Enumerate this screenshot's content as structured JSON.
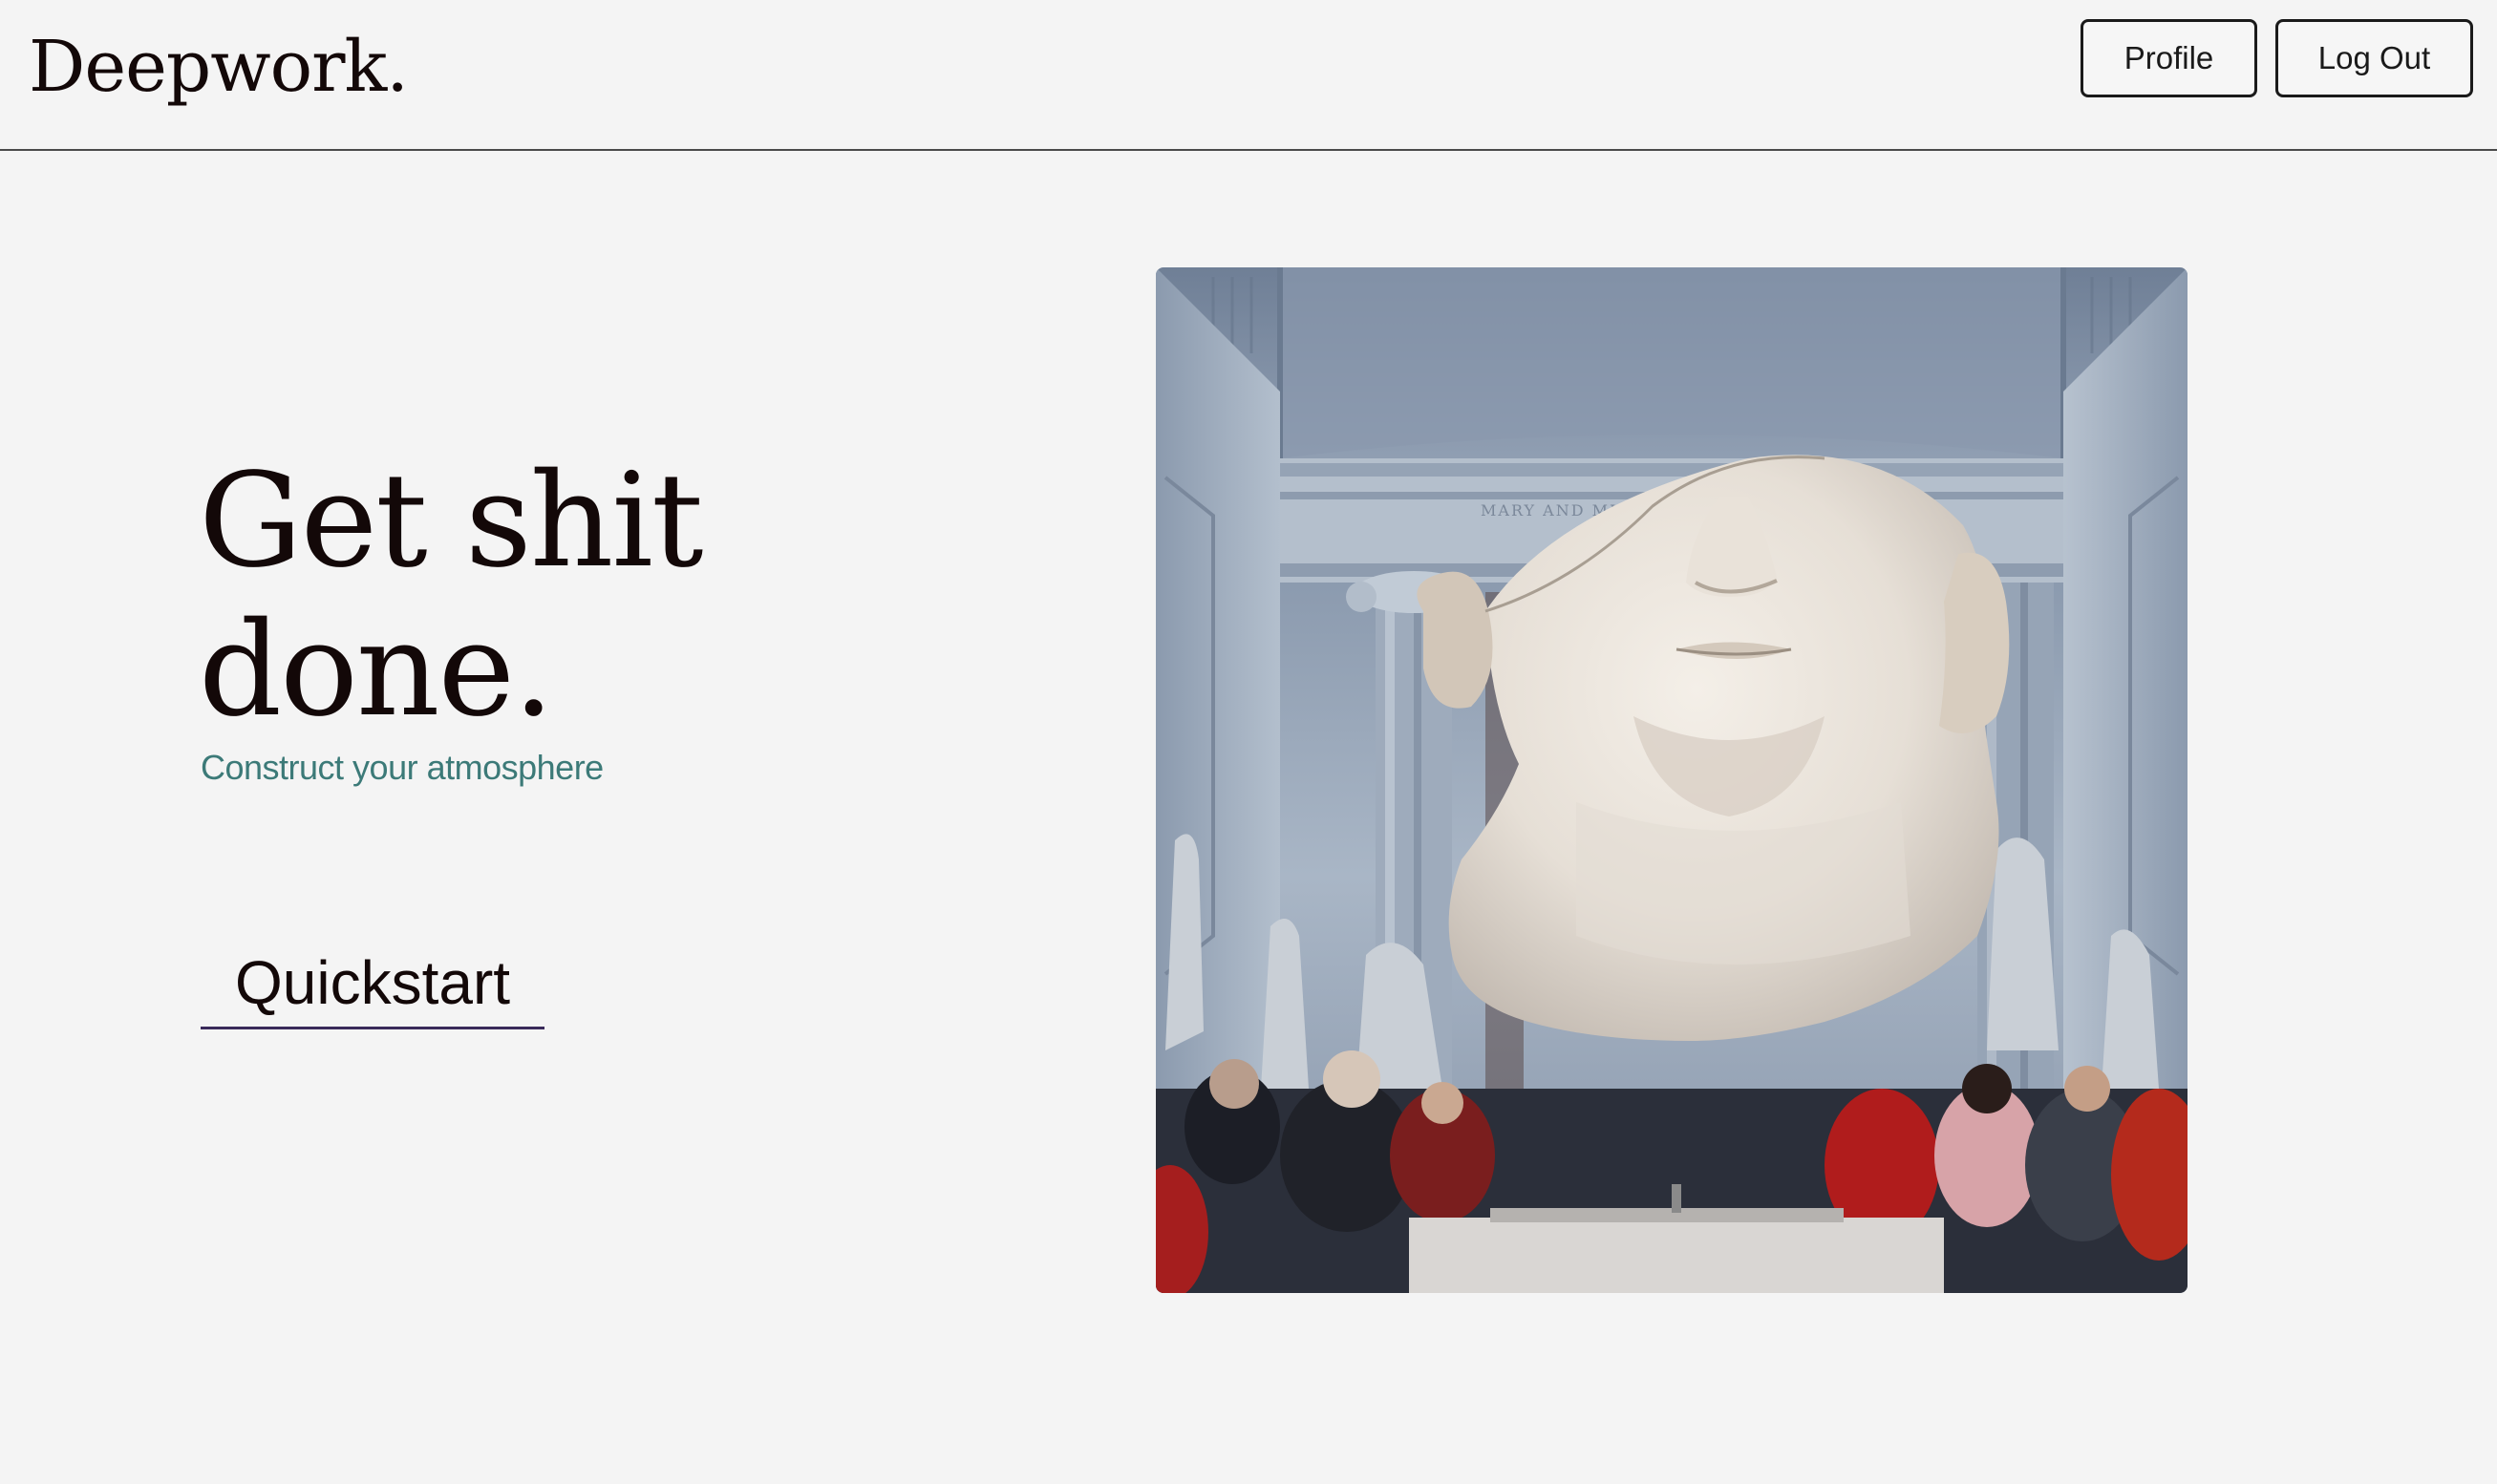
{
  "header": {
    "logo": "Deepwork.",
    "profile_label": "Profile",
    "logout_label": "Log Out"
  },
  "hero": {
    "headline_line1": "Get shit",
    "headline_line2": "done.",
    "subtitle": "Construct your atmosphere",
    "quickstart_label": "Quickstart",
    "image_inscription": "MARY AND MICHAEL"
  },
  "colors": {
    "background": "#f4f4f4",
    "text": "#130808",
    "subtitle_accent": "#3c7a78",
    "quickstart_underline": "#3a2a5a",
    "navbar_border": "#4a4a4a"
  }
}
